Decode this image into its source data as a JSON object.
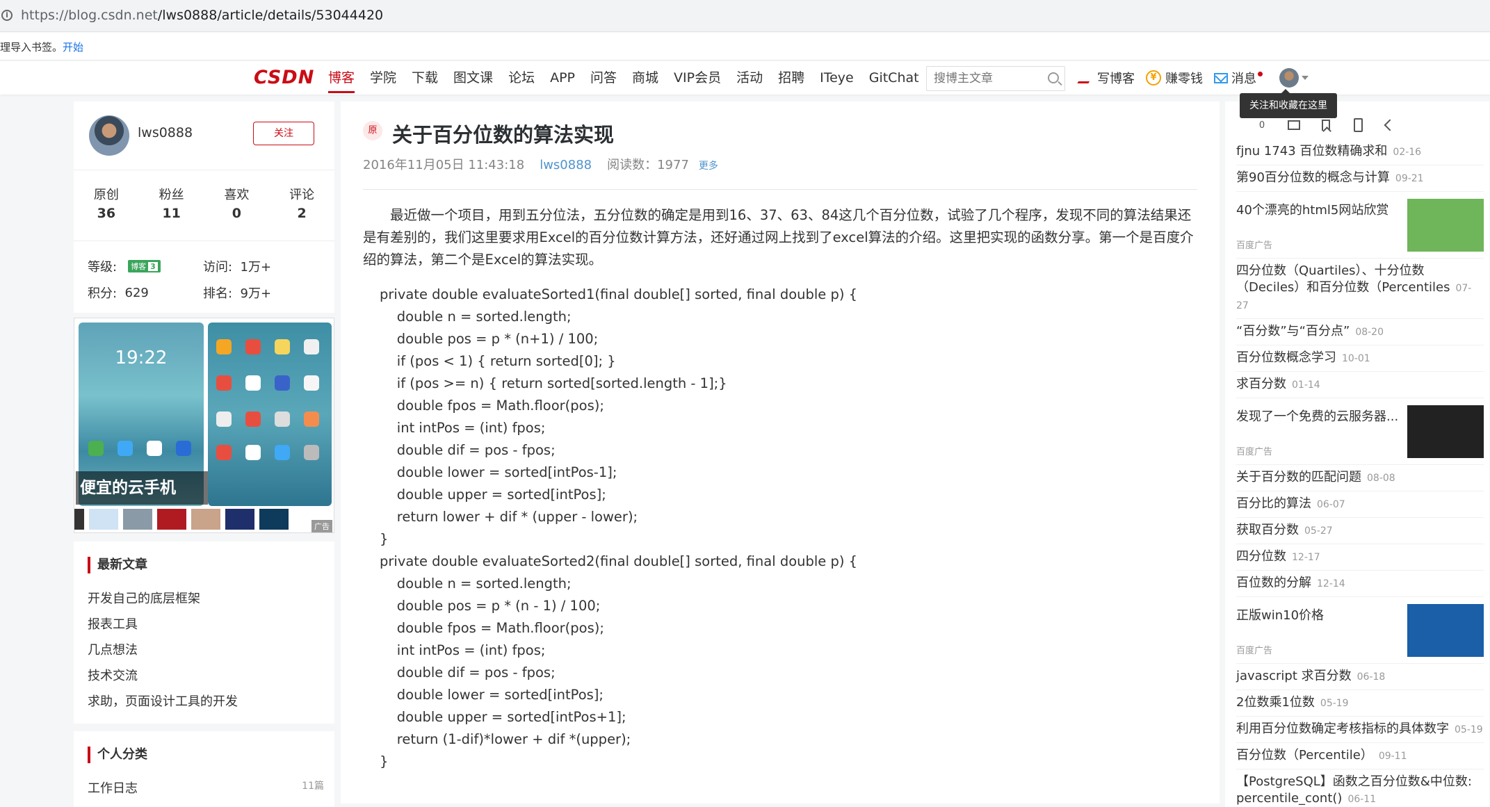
{
  "browser": {
    "url_prefix": "https://blog.csdn.net",
    "url_path": "/lws0888/article/details/53044420",
    "bookmark_text": "理导入书签。",
    "bookmark_link": "开始"
  },
  "nav": {
    "logo": "CSDN",
    "items": [
      "博客",
      "学院",
      "下载",
      "图文课",
      "论坛",
      "APP",
      "问答",
      "商城",
      "VIP会员",
      "活动",
      "招聘",
      "ITeye",
      "GitChat"
    ],
    "search_placeholder": "搜博主文章",
    "write": "写博客",
    "earn": "赚零钱",
    "messages": "消息",
    "tooltip": "关注和收藏在这里",
    "accent_color": "#ca0c16"
  },
  "profile": {
    "username": "lws0888",
    "follow": "关注",
    "stats": [
      {
        "label": "原创",
        "value": "36"
      },
      {
        "label": "粉丝",
        "value": "11"
      },
      {
        "label": "喜欢",
        "value": "0"
      },
      {
        "label": "评论",
        "value": "2"
      }
    ],
    "level_label": "等级:",
    "level_badge": "博客",
    "level_num": "3",
    "visits_label": "访问:",
    "visits": "1万+",
    "points_label": "积分:",
    "points": "629",
    "rank_label": "排名:",
    "rank": "9万+"
  },
  "ad_left": {
    "phone_time": "19:22",
    "title": "便宜的云手机",
    "tag": "广告"
  },
  "recent": {
    "title": "最新文章",
    "items": [
      "开发自己的底层框架",
      "报表工具",
      "几点想法",
      "技术交流",
      "求助，页面设计工具的开发"
    ]
  },
  "categories": {
    "title": "个人分类",
    "items": [
      {
        "name": "工作日志",
        "count": "11篇"
      }
    ]
  },
  "article": {
    "badge": "原",
    "title": "关于百分位数的算法实现",
    "date": "2016年11月05日 11:43:18",
    "author": "lws0888",
    "reads": "阅读数：1977",
    "more": "更多",
    "paragraph": "最近做一个项目，用到五分位法，五分位数的确定是用到16、37、63、84这几个百分位数，试验了几个程序，发现不同的算法结果还是有差别的，我们这里要求用Excel的百分位数计算方法，还好通过网上找到了excel算法的介绍。这里把实现的函数分享。第一个是百度介绍的算法，第二个是Excel的算法实现。",
    "code": "private double evaluateSorted1(final double[] sorted, final double p) {\n    double n = sorted.length;\n    double pos = p * (n+1) / 100;\n    if (pos < 1) { return sorted[0]; }\n    if (pos >= n) { return sorted[sorted.length - 1];}\n    double fpos = Math.floor(pos);\n    int intPos = (int) fpos;\n    double dif = pos - fpos;\n    double lower = sorted[intPos-1];\n    double upper = sorted[intPos];\n    return lower + dif * (upper - lower);\n}\nprivate double evaluateSorted2(final double[] sorted, final double p) {\n    double n = sorted.length;\n    double pos = p * (n - 1) / 100;\n    double fpos = Math.floor(pos);\n    int intPos = (int) fpos;\n    double dif = pos - fpos;\n    double lower = sorted[intPos];\n    double upper = sorted[intPos+1];\n    return (1-dif)*lower + dif *(upper);\n}"
  },
  "related": {
    "like_count": "0",
    "items": [
      {
        "kind": "link",
        "title": "fjnu 1743 百位数精确求和",
        "date": "02-16"
      },
      {
        "kind": "link",
        "title": "第90百分位数的概念与计算",
        "date": "09-21"
      },
      {
        "kind": "ad",
        "title": "40个漂亮的html5网站欣赏",
        "tag": "百度广告",
        "color": "#6fb55a"
      },
      {
        "kind": "link",
        "title": "四分位数（Quartiles）、十分位数（Deciles）和百分位数（Percentiles",
        "date": "07-27"
      },
      {
        "kind": "link",
        "title": "“百分数”与“百分点”",
        "date": "08-20"
      },
      {
        "kind": "link",
        "title": "百分位数概念学习",
        "date": "10-01"
      },
      {
        "kind": "link",
        "title": "求百分数",
        "date": "01-14"
      },
      {
        "kind": "ad",
        "title": "发现了一个免费的云服务器...",
        "tag": "百度广告",
        "color": "#222222"
      },
      {
        "kind": "link",
        "title": "关于百分数的匹配问题",
        "date": "08-08"
      },
      {
        "kind": "link",
        "title": "百分比的算法",
        "date": "06-07"
      },
      {
        "kind": "link",
        "title": "获取百分数",
        "date": "05-27"
      },
      {
        "kind": "link",
        "title": "四分位数",
        "date": "12-17"
      },
      {
        "kind": "link",
        "title": "百位数的分解",
        "date": "12-14"
      },
      {
        "kind": "ad",
        "title": "正版win10价格",
        "tag": "百度广告",
        "color": "#1a5fa8"
      },
      {
        "kind": "link",
        "title": "javascript 求百分数",
        "date": "06-18"
      },
      {
        "kind": "link",
        "title": "2位数乘1位数",
        "date": "05-19"
      },
      {
        "kind": "link",
        "title": "利用百分位数确定考核指标的具体数字",
        "date": "05-19"
      },
      {
        "kind": "link",
        "title": "百分位数（Percentile）",
        "date": "09-11"
      },
      {
        "kind": "link",
        "title": "【PostgreSQL】函数之百分位数&中位数: percentile_cont()",
        "date": "06-11"
      }
    ]
  }
}
